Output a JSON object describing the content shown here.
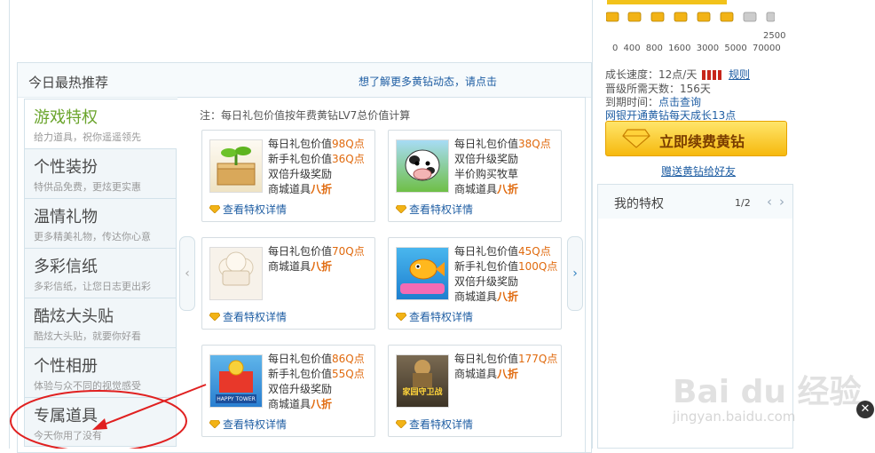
{
  "panel": {
    "title": "今日最热推荐",
    "more_link": "想了解更多黄钻动态，请点击"
  },
  "tabs": [
    {
      "name": "游戏特权",
      "desc": "给力道具，祝你遥遥领先"
    },
    {
      "name": "个性装扮",
      "desc": "特供品免费，更炫更实惠"
    },
    {
      "name": "温情礼物",
      "desc": "更多精美礼物，传达你心意"
    },
    {
      "name": "多彩信纸",
      "desc": "多彩信纸，让您日志更出彩"
    },
    {
      "name": "酷炫大头贴",
      "desc": "酷炫大头贴，就要你好看"
    },
    {
      "name": "个性相册",
      "desc": "体验与众不同的视觉感受"
    },
    {
      "name": "专属道具",
      "desc": "今天你用了没有"
    }
  ],
  "note": "注：每日礼包价值按年费黄钻LV7总价值计算",
  "cards": [
    {
      "icon": "seedling-box-icon",
      "lines": [
        [
          "每日礼包价值",
          "98Q点"
        ],
        [
          "新手礼包价值",
          "36Q点"
        ],
        [
          "双倍升级奖励",
          ""
        ],
        [
          "商城道具",
          "八折"
        ]
      ],
      "link": "查看特权详情"
    },
    {
      "icon": "cow-game-icon",
      "lines": [
        [
          "每日礼包价值",
          "38Q点"
        ],
        [
          "双倍升级奖励",
          ""
        ],
        [
          "半价购买牧草",
          ""
        ],
        [
          "商城道具",
          "八折"
        ]
      ],
      "link": "查看特权详情"
    },
    {
      "icon": "chef-hat-icon",
      "lines": [
        [
          "每日礼包价值",
          "70Q点"
        ],
        [
          "商城道具",
          "八折"
        ]
      ],
      "link": "查看特权详情"
    },
    {
      "icon": "fish-game-icon",
      "lines": [
        [
          "每日礼包价值",
          "45Q点"
        ],
        [
          "新手礼包价值",
          "100Q点"
        ],
        [
          "双倍升级奖励",
          ""
        ],
        [
          "商城道具",
          "八折"
        ]
      ],
      "link": "查看特权详情"
    },
    {
      "icon": "happy-tower-icon",
      "lines": [
        [
          "每日礼包价值",
          "86Q点"
        ],
        [
          "新手礼包价值",
          "55Q点"
        ],
        [
          "双倍升级奖励",
          ""
        ],
        [
          "商城道具",
          "八折"
        ]
      ],
      "link": "查看特权详情"
    },
    {
      "icon": "home-guard-icon",
      "lines": [
        [
          "每日礼包价值",
          "177Q点"
        ],
        [
          "商城道具",
          "八折"
        ]
      ],
      "link": "查看特权详情"
    }
  ],
  "card_images": {
    "happy_tower_text": "HAPPY TOWER",
    "home_guard_text": "家园守卫战"
  },
  "levels": {
    "scale": "0 400 800 1600 3000 5000 70000",
    "scale_top": "2500"
  },
  "vip_info": {
    "growth_label": "成长速度：12点/天",
    "rules_link": "规则",
    "days_label": "晋级所需天数：156天",
    "expire_label": "到期时间：",
    "expire_link": "点击查询",
    "bank_link": "网银开通黄钻每天成长13点",
    "renew_button": "立即续费黄钻",
    "gift_link": "赠送黄钻给好友"
  },
  "privilege": {
    "title": "我的特权",
    "page": "1/2"
  },
  "watermark": {
    "main": "Bai du 经验",
    "sub": "jingyan.baidu.com"
  },
  "colors": {
    "accent_green": "#6aa42b",
    "link_blue": "#1f5ea3",
    "value_orange": "#e06a0e",
    "annotation_red": "#e02020"
  }
}
